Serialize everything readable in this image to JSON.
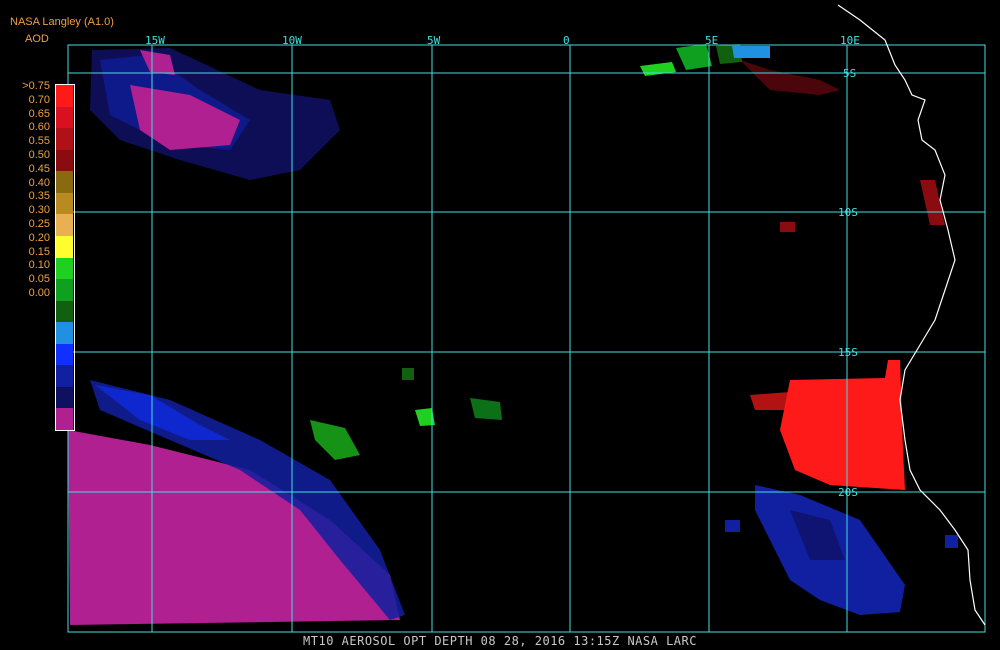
{
  "header": {
    "source": "NASA Langley (A1.0)",
    "product": "AOD"
  },
  "legend": {
    "labels": [
      ">0.75",
      "0.70",
      "0.65",
      "0.60",
      "0.55",
      "0.50",
      "0.45",
      "0.40",
      "0.35",
      "0.30",
      "0.25",
      "0.20",
      "0.15",
      "0.10",
      "0.05",
      "0.00"
    ],
    "colors": [
      "#ff1a1a",
      "#d81020",
      "#b01018",
      "#8a0c10",
      "#8a6a10",
      "#b88a20",
      "#e8b050",
      "#ffff30",
      "#20d020",
      "#10a020",
      "#106010",
      "#2090e0",
      "#1030ff",
      "#1020a0",
      "#101060",
      "#b02090"
    ]
  },
  "grid": {
    "lon_labels": [
      "15W",
      "10W",
      "5W",
      "0",
      "5E",
      "10E"
    ],
    "lat_labels": [
      "5S",
      "10S",
      "15S",
      "20S"
    ]
  },
  "footer": {
    "caption": "MT10  AEROSOL OPT DEPTH   08 28, 2016 13:15Z   NASA LARC"
  },
  "colors": {
    "grid": "#40e0e0",
    "coast": "#ffffff",
    "background": "#000000",
    "label_text": "#f0a040"
  }
}
